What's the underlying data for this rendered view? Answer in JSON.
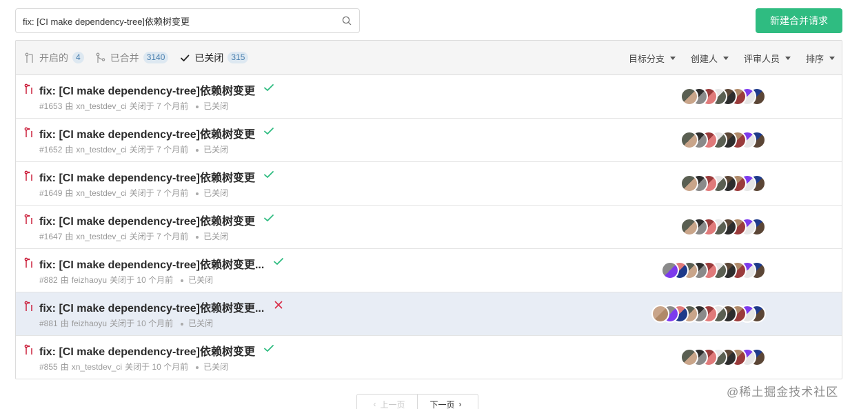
{
  "search": {
    "value": "fix: [CI make dependency-tree]依赖树变更"
  },
  "new_button": {
    "label": "新建合并请求",
    "color": "#2fbc81"
  },
  "tabs": [
    {
      "label": "开启的",
      "count": "4",
      "icon": "pull-request-open-icon"
    },
    {
      "label": "已合并",
      "count": "3140",
      "icon": "merge-icon"
    },
    {
      "label": "已关闭",
      "count": "315",
      "icon": "check-icon",
      "active": true
    }
  ],
  "filters": [
    {
      "label": "目标分支"
    },
    {
      "label": "创建人"
    },
    {
      "label": "评审人员"
    },
    {
      "label": "排序"
    }
  ],
  "rows": [
    {
      "title": "fix: [CI make dependency-tree]依赖树变更",
      "number": "#1653",
      "by": "由",
      "author": "xn_testdev_ci",
      "closed_text": "关闭于 7 个月前",
      "state": "已关闭",
      "check": "pass"
    },
    {
      "title": "fix: [CI make dependency-tree]依赖树变更",
      "number": "#1652",
      "by": "由",
      "author": "xn_testdev_ci",
      "closed_text": "关闭于 7 个月前",
      "state": "已关闭",
      "check": "pass"
    },
    {
      "title": "fix: [CI make dependency-tree]依赖树变更",
      "number": "#1649",
      "by": "由",
      "author": "xn_testdev_ci",
      "closed_text": "关闭于 7 个月前",
      "state": "已关闭",
      "check": "pass"
    },
    {
      "title": "fix: [CI make dependency-tree]依赖树变更",
      "number": "#1647",
      "by": "由",
      "author": "xn_testdev_ci",
      "closed_text": "关闭于 7 个月前",
      "state": "已关闭",
      "check": "pass"
    },
    {
      "title": "fix: [CI make dependency-tree]依赖树变更...",
      "number": "#882",
      "by": "由",
      "author": "feizhaoyu",
      "closed_text": "关闭于 10 个月前",
      "state": "已关闭",
      "check": "pass"
    },
    {
      "title": "fix: [CI make dependency-tree]依赖树变更...",
      "number": "#881",
      "by": "由",
      "author": "feizhaoyu",
      "closed_text": "关闭于 10 个月前",
      "state": "已关闭",
      "check": "fail"
    },
    {
      "title": "fix: [CI make dependency-tree]依赖树变更",
      "number": "#855",
      "by": "由",
      "author": "xn_testdev_ci",
      "closed_text": "关闭于 10 个月前",
      "state": "已关闭",
      "check": "pass"
    }
  ],
  "pager": {
    "prev": "上一页",
    "next": "下一页"
  },
  "watermark": "@稀土掘金技术社区",
  "colors": {
    "closed_icon": "#c8102e",
    "pass": "#2fbc81",
    "fail": "#d9304a",
    "tab_badge_bg": "#dde8f1"
  }
}
